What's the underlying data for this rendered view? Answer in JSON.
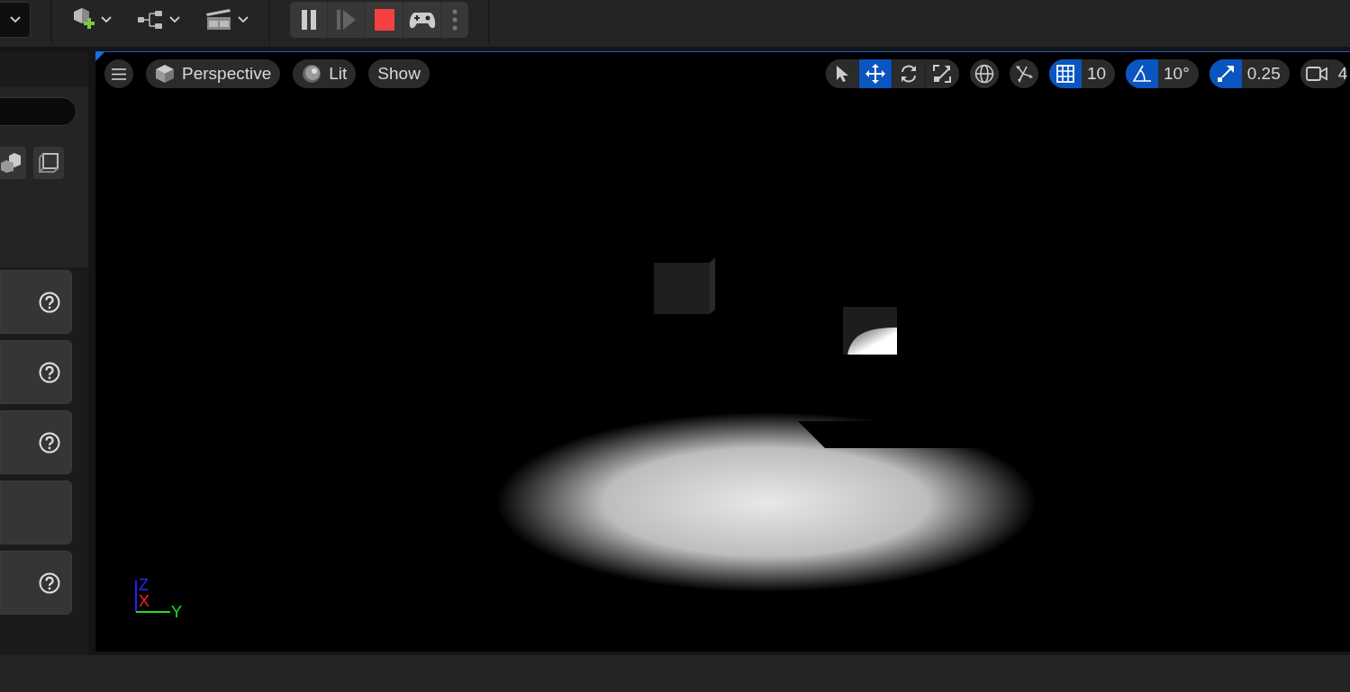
{
  "main_toolbar": {
    "mode_dropdown": {
      "kind": "dropdown"
    },
    "tools": [
      {
        "kind": "add-actor"
      },
      {
        "kind": "blueprint"
      },
      {
        "kind": "cinematics"
      }
    ],
    "play_controls": [
      {
        "kind": "pause",
        "disabled": false
      },
      {
        "kind": "step",
        "disabled": true
      },
      {
        "kind": "stop",
        "disabled": false
      },
      {
        "kind": "possess",
        "disabled": false
      },
      {
        "kind": "more",
        "disabled": false
      }
    ]
  },
  "left_panel": {
    "view_buttons": [
      {
        "kind": "shapes"
      },
      {
        "kind": "cube"
      }
    ],
    "cards": [
      {
        "help": true
      },
      {
        "help": true
      },
      {
        "help": true
      },
      {
        "help": false
      },
      {
        "help": true
      }
    ]
  },
  "viewport": {
    "left_controls": [
      {
        "kind": "menu"
      },
      {
        "kind": "perspective",
        "label": "Perspective"
      },
      {
        "kind": "lit",
        "label": "Lit"
      },
      {
        "kind": "show",
        "label": "Show"
      }
    ],
    "transform_tools": [
      {
        "kind": "select",
        "selected": false
      },
      {
        "kind": "move",
        "selected": true
      },
      {
        "kind": "rotate",
        "selected": false
      },
      {
        "kind": "scale",
        "selected": false
      }
    ],
    "world_local": {
      "kind": "globe"
    },
    "surface_snap": {
      "kind": "snap"
    },
    "snaps": [
      {
        "kind": "grid",
        "on": true,
        "value": "10"
      },
      {
        "kind": "angle",
        "on": true,
        "value": "10°"
      },
      {
        "kind": "scale",
        "on": true,
        "value": "0.25"
      },
      {
        "kind": "camera",
        "on": false,
        "value": "4"
      }
    ],
    "axes": [
      "Z",
      "X",
      "Y"
    ]
  }
}
